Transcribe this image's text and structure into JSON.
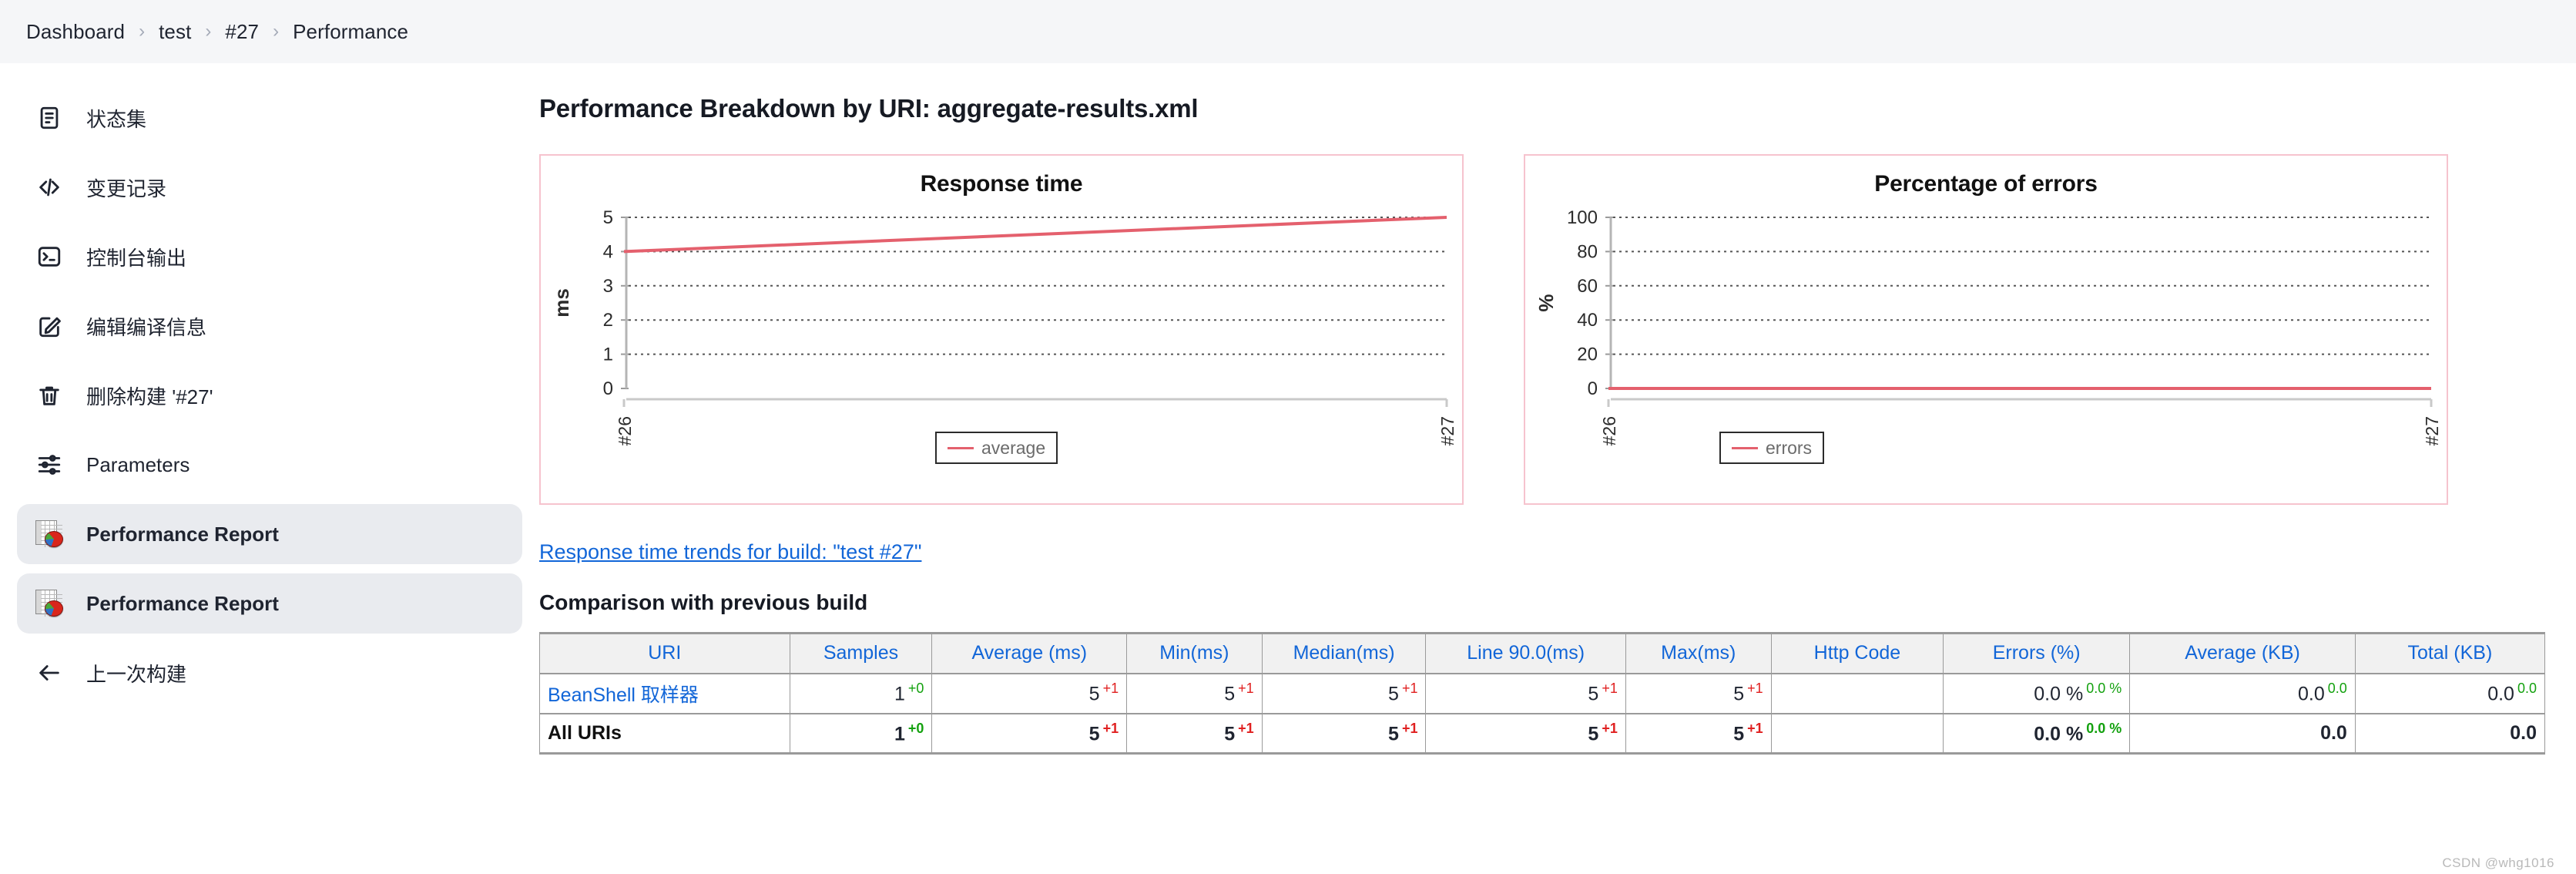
{
  "breadcrumb": {
    "items": [
      "Dashboard",
      "test",
      "#27",
      "Performance"
    ],
    "separator": "›"
  },
  "sidebar": {
    "items": [
      {
        "label": "状态集",
        "icon": "document-icon",
        "selected": false
      },
      {
        "label": "变更记录",
        "icon": "code-icon",
        "selected": false
      },
      {
        "label": "控制台输出",
        "icon": "terminal-icon",
        "selected": false
      },
      {
        "label": "编辑编译信息",
        "icon": "edit-icon",
        "selected": false
      },
      {
        "label": "删除构建 '#27'",
        "icon": "trash-icon",
        "selected": false
      },
      {
        "label": "Parameters",
        "icon": "sliders-icon",
        "selected": false
      },
      {
        "label": "Performance Report",
        "icon": "report-icon",
        "selected": true
      },
      {
        "label": "Performance Report",
        "icon": "report-icon",
        "selected": true
      },
      {
        "label": "上一次构建",
        "icon": "arrow-left-icon",
        "selected": false
      }
    ]
  },
  "main": {
    "page_title": "Performance Breakdown by URI: aggregate-results.xml",
    "trend_link": "Response time trends for build: \"test #27\"",
    "compare_heading": "Comparison with previous build",
    "watermark": "CSDN @whg1016"
  },
  "chart_data": [
    {
      "type": "line",
      "title": "Response time",
      "xlabel": "",
      "ylabel": "ms",
      "categories": [
        "#26",
        "#27"
      ],
      "x": [
        "#26",
        "#27"
      ],
      "series": [
        {
          "name": "average",
          "values": [
            4.0,
            5.0
          ],
          "color": "#e4606d"
        }
      ],
      "ylim": [
        0,
        5
      ],
      "yticks": [
        0,
        1,
        2,
        3,
        4,
        5
      ],
      "grid": true,
      "legend": "bottom-right",
      "legend_entries": [
        "average"
      ],
      "panel_border_color": "#f6c3ce"
    },
    {
      "type": "line",
      "title": "Percentage of errors",
      "xlabel": "",
      "ylabel": "%",
      "categories": [
        "#26",
        "#27"
      ],
      "x": [
        "#26",
        "#27"
      ],
      "series": [
        {
          "name": "errors",
          "values": [
            0,
            0
          ],
          "color": "#e4606d"
        }
      ],
      "ylim": [
        0,
        100
      ],
      "yticks": [
        0,
        20,
        40,
        60,
        80,
        100
      ],
      "grid": true,
      "legend": "bottom-left",
      "legend_entries": [
        "errors"
      ],
      "panel_border_color": "#f6c3ce"
    }
  ],
  "table": {
    "columns": [
      "URI",
      "Samples",
      "Average (ms)",
      "Min(ms)",
      "Median(ms)",
      "Line 90.0(ms)",
      "Max(ms)",
      "Http Code",
      "Errors (%)",
      "Average (KB)",
      "Total (KB)"
    ],
    "rows": [
      {
        "uri": "BeanShell 取样器",
        "uri_is_link": true,
        "is_total": false,
        "cells": [
          {
            "value": "1",
            "delta": "+0",
            "delta_kind": "flat"
          },
          {
            "value": "5",
            "delta": "+1",
            "delta_kind": "up"
          },
          {
            "value": "5",
            "delta": "+1",
            "delta_kind": "up"
          },
          {
            "value": "5",
            "delta": "+1",
            "delta_kind": "up"
          },
          {
            "value": "5",
            "delta": "+1",
            "delta_kind": "up"
          },
          {
            "value": "5",
            "delta": "+1",
            "delta_kind": "up"
          },
          {
            "value": "",
            "delta": "",
            "delta_kind": "none"
          },
          {
            "value": "0.0 %",
            "delta": "0.0 %",
            "delta_kind": "flat"
          },
          {
            "value": "0.0",
            "delta": "0.0",
            "delta_kind": "flat"
          },
          {
            "value": "0.0",
            "delta": "0.0",
            "delta_kind": "flat"
          }
        ]
      },
      {
        "uri": "All URIs",
        "uri_is_link": false,
        "is_total": true,
        "cells": [
          {
            "value": "1",
            "delta": "+0",
            "delta_kind": "flat"
          },
          {
            "value": "5",
            "delta": "+1",
            "delta_kind": "up"
          },
          {
            "value": "5",
            "delta": "+1",
            "delta_kind": "up"
          },
          {
            "value": "5",
            "delta": "+1",
            "delta_kind": "up"
          },
          {
            "value": "5",
            "delta": "+1",
            "delta_kind": "up"
          },
          {
            "value": "5",
            "delta": "+1",
            "delta_kind": "up"
          },
          {
            "value": "",
            "delta": "",
            "delta_kind": "none"
          },
          {
            "value": "0.0 %",
            "delta": "0.0 %",
            "delta_kind": "flat"
          },
          {
            "value": "0.0",
            "delta": "",
            "delta_kind": "none"
          },
          {
            "value": "0.0",
            "delta": "",
            "delta_kind": "none"
          }
        ]
      }
    ]
  }
}
